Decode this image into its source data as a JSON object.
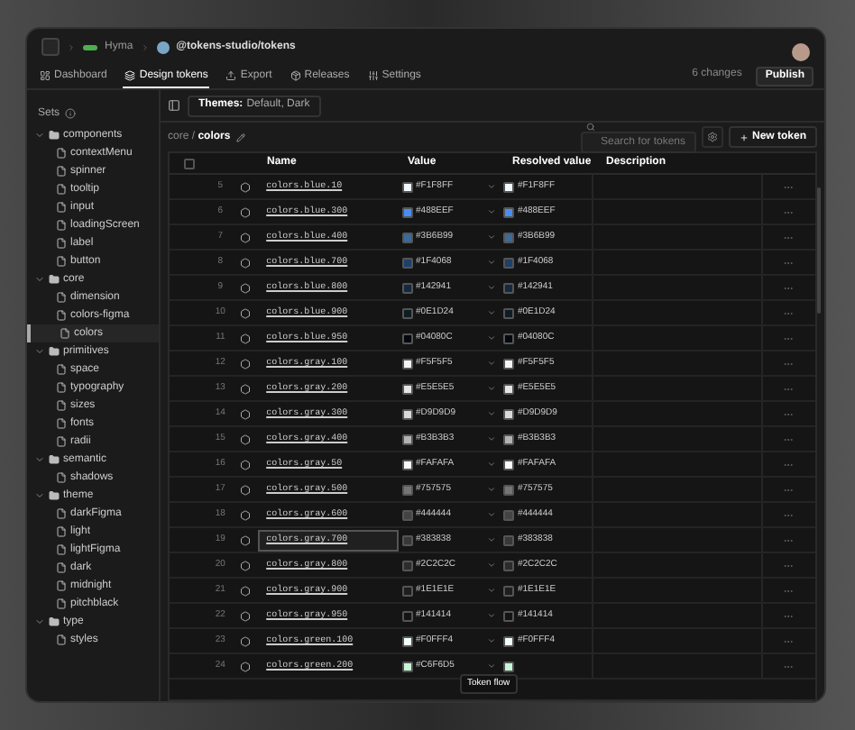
{
  "top": {
    "org": "Hyma",
    "repo": "@tokens-studio/tokens"
  },
  "tabs": [
    {
      "label": "Dashboard",
      "selected": false
    },
    {
      "label": "Design tokens",
      "selected": true
    },
    {
      "label": "Export",
      "selected": false
    },
    {
      "label": "Releases",
      "selected": false
    },
    {
      "label": "Settings",
      "selected": false
    }
  ],
  "changes": "6 changes",
  "publish": "Publish",
  "sidebar": {
    "title": "Sets",
    "items": [
      {
        "label": "components",
        "expanded": true,
        "children": [
          {
            "label": "contextMenu",
            "selected": false
          },
          {
            "label": "spinner",
            "selected": false
          },
          {
            "label": "tooltip",
            "selected": false
          },
          {
            "label": "input",
            "selected": false
          },
          {
            "label": "loadingScreen",
            "selected": false
          },
          {
            "label": "label",
            "selected": false
          },
          {
            "label": "button",
            "selected": false
          }
        ]
      },
      {
        "label": "core",
        "expanded": true,
        "children": [
          {
            "label": "dimension",
            "selected": false
          },
          {
            "label": "colors-figma",
            "selected": false
          },
          {
            "label": "colors",
            "selected": true
          }
        ]
      },
      {
        "label": "primitives",
        "expanded": true,
        "children": [
          {
            "label": "space",
            "selected": false
          },
          {
            "label": "typography",
            "selected": false
          },
          {
            "label": "sizes",
            "selected": false
          },
          {
            "label": "fonts",
            "selected": false
          },
          {
            "label": "radii",
            "selected": false
          }
        ]
      },
      {
        "label": "semantic",
        "expanded": true,
        "children": [
          {
            "label": "shadows",
            "selected": false
          }
        ]
      },
      {
        "label": "theme",
        "expanded": true,
        "children": [
          {
            "label": "darkFigma",
            "selected": false
          },
          {
            "label": "light",
            "selected": false
          },
          {
            "label": "lightFigma",
            "selected": false
          },
          {
            "label": "dark",
            "selected": false
          },
          {
            "label": "midnight",
            "selected": false
          },
          {
            "label": "pitchblack",
            "selected": false
          }
        ]
      },
      {
        "label": "type",
        "expanded": true,
        "children": [
          {
            "label": "styles",
            "selected": false
          }
        ]
      }
    ]
  },
  "themes": {
    "label": "Themes:",
    "value": "Default, Dark"
  },
  "path": "core / **colors**",
  "select_all": {
    "checked": false
  },
  "search": {
    "placeholder": "Search for tokens"
  },
  "new_token": "New token",
  "columns": [
    "Name",
    "Value",
    "Resolved value",
    "Description"
  ],
  "rows": [
    {
      "number": "5",
      "name": "colors.blue.10",
      "value": "#F1F8FF",
      "resolved": "#F1F8FF",
      "color": "#f1f8ff",
      "focused": false
    },
    {
      "number": "6",
      "name": "colors.blue.300",
      "value": "#488EEF",
      "resolved": "#488EEF",
      "color": "#488eef",
      "focused": false
    },
    {
      "number": "7",
      "name": "colors.blue.400",
      "value": "#3B6B99",
      "resolved": "#3B6B99",
      "color": "#3b6b99",
      "focused": false
    },
    {
      "number": "8",
      "name": "colors.blue.700",
      "value": "#1F4068",
      "resolved": "#1F4068",
      "color": "#1f4068",
      "focused": false
    },
    {
      "number": "9",
      "name": "colors.blue.800",
      "value": "#142941",
      "resolved": "#142941",
      "color": "#142941",
      "focused": false
    },
    {
      "number": "10",
      "name": "colors.blue.900",
      "value": "#0E1D24",
      "resolved": "#0E1D24",
      "color": "#0e1d24",
      "focused": false
    },
    {
      "number": "11",
      "name": "colors.blue.950",
      "value": "#04080C",
      "resolved": "#04080C",
      "color": "#04080c",
      "focused": false
    },
    {
      "number": "12",
      "name": "colors.gray.100",
      "value": "#F5F5F5",
      "resolved": "#F5F5F5",
      "color": "#f5f5f5",
      "focused": false
    },
    {
      "number": "13",
      "name": "colors.gray.200",
      "value": "#E5E5E5",
      "resolved": "#E5E5E5",
      "color": "#e5e5e5",
      "focused": false
    },
    {
      "number": "14",
      "name": "colors.gray.300",
      "value": "#D9D9D9",
      "resolved": "#D9D9D9",
      "color": "#d9d9d9",
      "focused": false
    },
    {
      "number": "15",
      "name": "colors.gray.400",
      "value": "#B3B3B3",
      "resolved": "#B3B3B3",
      "color": "#b3b3b3",
      "focused": false
    },
    {
      "number": "16",
      "name": "colors.gray.50",
      "value": "#FAFAFA",
      "resolved": "#FAFAFA",
      "color": "#fafafa",
      "focused": false
    },
    {
      "number": "17",
      "name": "colors.gray.500",
      "value": "#757575",
      "resolved": "#757575",
      "color": "#757575",
      "focused": false
    },
    {
      "number": "18",
      "name": "colors.gray.600",
      "value": "#444444",
      "resolved": "#444444",
      "color": "#444444",
      "focused": false
    },
    {
      "number": "19",
      "name": "colors.gray.700",
      "value": "#383838",
      "resolved": "#383838",
      "color": "#383838",
      "focused": true
    },
    {
      "number": "20",
      "name": "colors.gray.800",
      "value": "#2C2C2C",
      "resolved": "#2C2C2C",
      "color": "#2c2c2c",
      "focused": false
    },
    {
      "number": "21",
      "name": "colors.gray.900",
      "value": "#1E1E1E",
      "resolved": "#1E1E1E",
      "color": "#1e1e1e",
      "focused": false
    },
    {
      "number": "22",
      "name": "colors.gray.950",
      "value": "#141414",
      "resolved": "#141414",
      "color": "#141414",
      "focused": false
    },
    {
      "number": "23",
      "name": "colors.green.100",
      "value": "#F0FFF4",
      "resolved": "#F0FFF4",
      "color": "#f0fff4",
      "focused": false
    },
    {
      "number": "24",
      "name": "colors.green.200",
      "value": "#C6F6D5",
      "color": "#c6f6d5",
      "focused": false
    }
  ],
  "tooltip": "Token flow"
}
